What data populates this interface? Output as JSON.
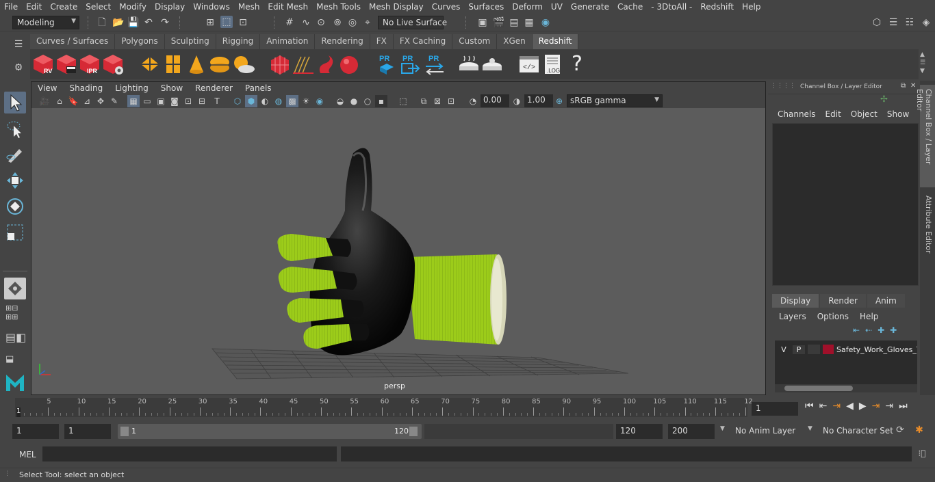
{
  "menubar": [
    "File",
    "Edit",
    "Create",
    "Select",
    "Modify",
    "Display",
    "Windows",
    "Mesh",
    "Edit Mesh",
    "Mesh Tools",
    "Mesh Display",
    "Curves",
    "Surfaces",
    "Deform",
    "UV",
    "Generate",
    "Cache",
    "- 3DtoAll -",
    "Redshift",
    "Help"
  ],
  "status": {
    "mode": "Modeling",
    "live_surface": "No Live Surface"
  },
  "shelf_tabs": [
    "Curves / Surfaces",
    "Polygons",
    "Sculpting",
    "Rigging",
    "Animation",
    "Rendering",
    "FX",
    "FX Caching",
    "Custom",
    "XGen",
    "Redshift"
  ],
  "shelf_active": "Redshift",
  "shelf_icon_labels": {
    "rv": "RV",
    "ipr": "IPR",
    "pr": "PR",
    "log": ".LOG",
    "help": "?"
  },
  "viewport": {
    "menu": [
      "View",
      "Shading",
      "Lighting",
      "Show",
      "Renderer",
      "Panels"
    ],
    "exposure": "0.00",
    "gamma": "1.00",
    "color_space": "sRGB gamma",
    "camera_label": "persp"
  },
  "channel_box": {
    "title": "Channel Box / Layer Editor",
    "menu": [
      "Channels",
      "Edit",
      "Object",
      "Show"
    ]
  },
  "layer_editor": {
    "tabs": [
      "Display",
      "Render",
      "Anim"
    ],
    "active_tab": "Display",
    "menu": [
      "Layers",
      "Options",
      "Help"
    ],
    "layers": [
      {
        "v": "V",
        "p": "P",
        "name": "Safety_Work_Gloves_T",
        "color": "#a0102a"
      }
    ]
  },
  "side_tabs": [
    "Channel Box / Layer Editor",
    "Attribute Editor"
  ],
  "timeline": {
    "ticks": [
      "5",
      "10",
      "15",
      "20",
      "25",
      "30",
      "35",
      "40",
      "45",
      "50",
      "55",
      "60",
      "65",
      "70",
      "75",
      "80",
      "85",
      "90",
      "95",
      "100",
      "105",
      "110",
      "115",
      "12"
    ],
    "current_frame_marker": "1",
    "current_frame": "1"
  },
  "range": {
    "start": "1",
    "playback_start": "1",
    "slider_start": "1",
    "slider_end": "120",
    "playback_end": "120",
    "end": "200",
    "anim_layer": "No Anim Layer",
    "character_set": "No Character Set"
  },
  "mel": {
    "label": "MEL"
  },
  "help_line": "Select Tool: select an object",
  "colors": {
    "accent": "#5d6f85",
    "glove_green": "#9ccc1a",
    "glove_black": "#111111"
  }
}
